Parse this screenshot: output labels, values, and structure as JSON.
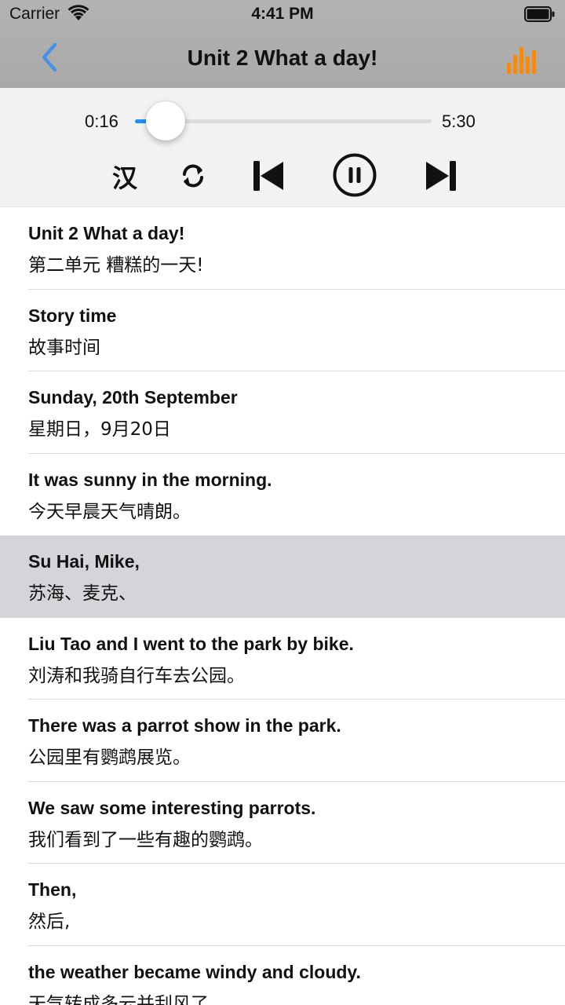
{
  "status_bar": {
    "carrier": "Carrier",
    "time": "4:41 PM"
  },
  "nav": {
    "title": "Unit 2 What a day!",
    "back_icon": "chevron-left-icon",
    "right_icon": "bar-chart-icon",
    "accent": "#4a90e2",
    "right_color": "#ff8a00"
  },
  "player": {
    "current_time": "0:16",
    "total_time": "5:30",
    "progress": 0.048,
    "chinese_toggle_label": "汉",
    "controls": [
      "loop-icon",
      "skip-previous-icon",
      "pause-icon",
      "skip-next-icon"
    ]
  },
  "sentences": [
    {
      "en": "Unit 2 What a day!",
      "zh": "第二单元 糟糕的一天!"
    },
    {
      "en": "Story time",
      "zh": "故事时间"
    },
    {
      "en": "Sunday, 20th September",
      "zh": "星期日，9月20日"
    },
    {
      "en": "It was sunny in the morning.",
      "zh": "今天早晨天气晴朗。"
    },
    {
      "en": "Su Hai, Mike,",
      "zh": "苏海、麦克、",
      "active": true
    },
    {
      "en": "Liu Tao and I went to the park by bike.",
      "zh": "刘涛和我骑自行车去公园。"
    },
    {
      "en": "There was a parrot show in the park.",
      "zh": "公园里有鹦鹉展览。"
    },
    {
      "en": "We saw some interesting parrots.",
      "zh": "我们看到了一些有趣的鹦鹉。"
    },
    {
      "en": "Then,",
      "zh": "然后,"
    },
    {
      "en": "the weather became windy and cloudy.",
      "zh": "天气转成多云并刮风了。"
    }
  ]
}
